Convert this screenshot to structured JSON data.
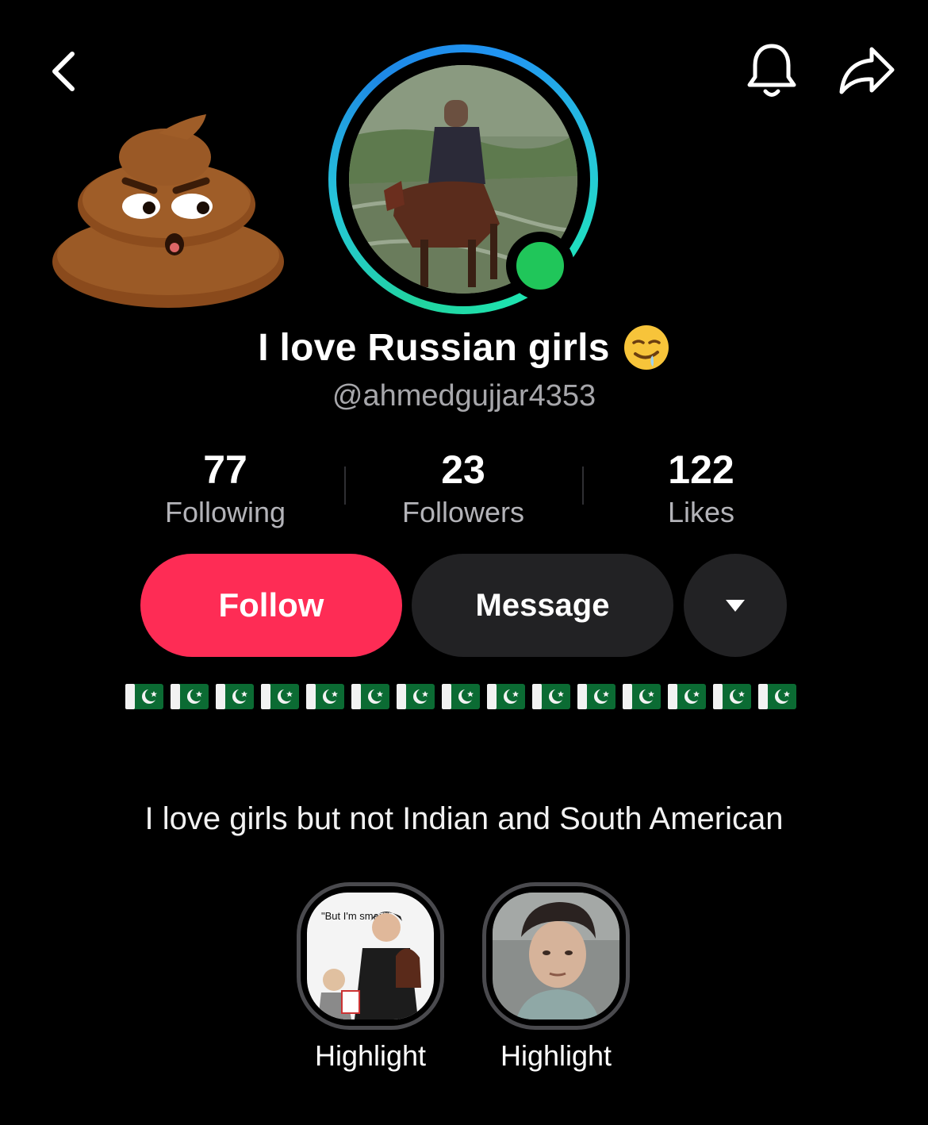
{
  "nav": {
    "back_icon": "chevron-left-icon",
    "bell_icon": "bell-icon",
    "share_icon": "share-arrow-icon"
  },
  "profile": {
    "sticker_icon": "angry-poop-emoji",
    "avatar_status": "online",
    "display_name": "I love Russian girls",
    "name_emoji": "drooling-face-emoji",
    "username": "@ahmedgujjar4353"
  },
  "stats": [
    {
      "value": "77",
      "label": "Following"
    },
    {
      "value": "23",
      "label": "Followers"
    },
    {
      "value": "122",
      "label": "Likes"
    }
  ],
  "actions": {
    "follow_label": "Follow",
    "message_label": "Message",
    "more_icon": "caret-down-icon"
  },
  "flags": {
    "emoji": "pakistan-flag",
    "count": 15
  },
  "bio": "I love girls but not Indian and South American",
  "highlights": [
    {
      "label": "Highlight",
      "caption": "\"But I'm smart\""
    },
    {
      "label": "Highlight"
    }
  ],
  "colors": {
    "background": "#000000",
    "follow": "#fe2c55",
    "secondary_button": "#222224",
    "online": "#20c65a",
    "muted_text": "#a7a7ab"
  }
}
